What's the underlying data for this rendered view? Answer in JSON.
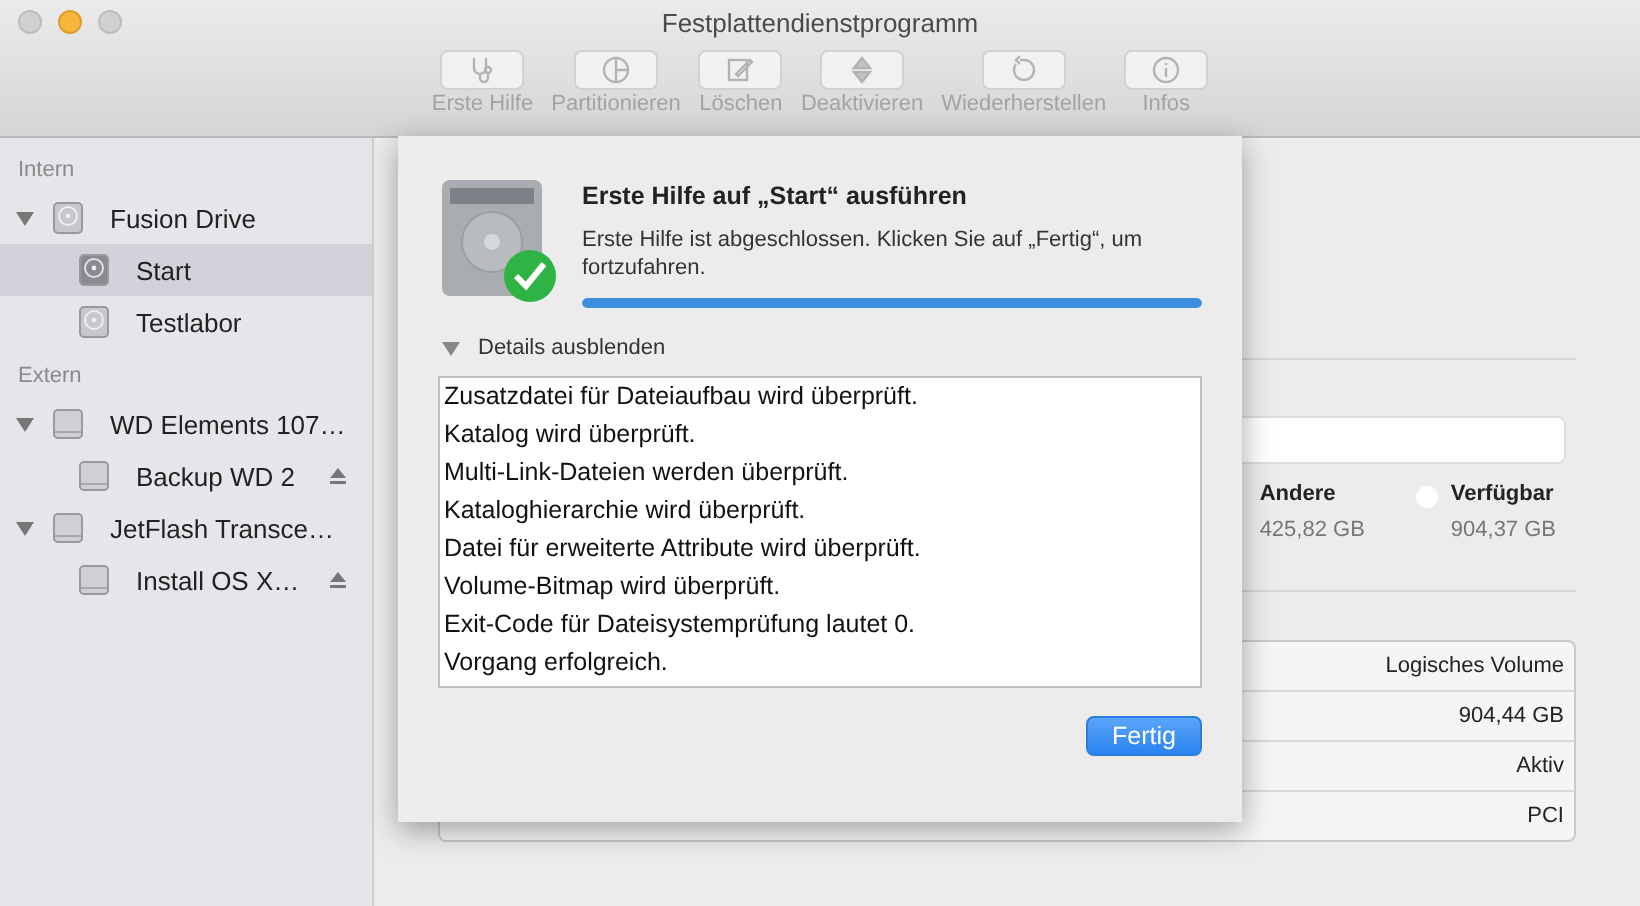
{
  "window": {
    "title": "Festplattendienstprogramm"
  },
  "toolbar": [
    {
      "label": "Erste Hilfe",
      "disabled": true
    },
    {
      "label": "Partitionieren",
      "disabled": true
    },
    {
      "label": "Löschen",
      "disabled": true
    },
    {
      "label": "Deaktivieren",
      "disabled": true
    },
    {
      "label": "Wiederherstellen",
      "disabled": true
    },
    {
      "label": "Infos",
      "disabled": true
    }
  ],
  "sidebar": {
    "sections": [
      {
        "title": "Intern",
        "items": [
          {
            "label": "Fusion Drive",
            "kind": "internal",
            "expanded": true,
            "selected": false,
            "children": [
              {
                "label": "Start",
                "kind": "internal",
                "selected": true,
                "ejectable": false
              },
              {
                "label": "Testlabor",
                "kind": "internal",
                "selected": false,
                "ejectable": false
              }
            ]
          }
        ]
      },
      {
        "title": "Extern",
        "items": [
          {
            "label": "WD Elements 107…",
            "kind": "external",
            "expanded": true,
            "selected": false,
            "children": [
              {
                "label": "Backup WD 2",
                "kind": "external",
                "selected": false,
                "ejectable": true
              }
            ]
          },
          {
            "label": "JetFlash Transce…",
            "kind": "external",
            "expanded": true,
            "selected": false,
            "children": [
              {
                "label": "Install OS X…",
                "kind": "external",
                "selected": false,
                "ejectable": true
              }
            ]
          }
        ]
      }
    ]
  },
  "usage": {
    "legend": [
      {
        "label": "Andere",
        "value": "425,82 GB"
      },
      {
        "label": "Verfügbar",
        "value": "904,37 GB",
        "color": "#ffffff"
      }
    ]
  },
  "info_table": {
    "rows": [
      {
        "value": "Logisches Volume"
      },
      {
        "value": "904,44 GB"
      },
      {
        "value": "Aktiv"
      },
      {
        "value": "PCI"
      }
    ]
  },
  "sheet": {
    "title": "Erste Hilfe auf „Start“ ausführen",
    "message": "Erste Hilfe ist abgeschlossen. Klicken Sie auf „Fertig“, um fortzufahren.",
    "progress": {
      "level": 1.0
    },
    "details_toggle": {
      "label": "Details ausblenden",
      "expanded": true
    },
    "log": [
      "Zusatzdatei für Dateiaufbau wird überprüft.",
      "Katalog wird überprüft.",
      "Multi-Link-Dateien werden überprüft.",
      "Kataloghierarchie wird überprüft.",
      "Datei für erweiterte Attribute wird überprüft.",
      "Volume-Bitmap wird überprüft.",
      "Exit-Code für Dateisystemprüfung lautet 0.",
      "Vorgang erfolgreich."
    ],
    "buttons": [
      {
        "label": "Fertig",
        "kind": "default"
      }
    ]
  }
}
